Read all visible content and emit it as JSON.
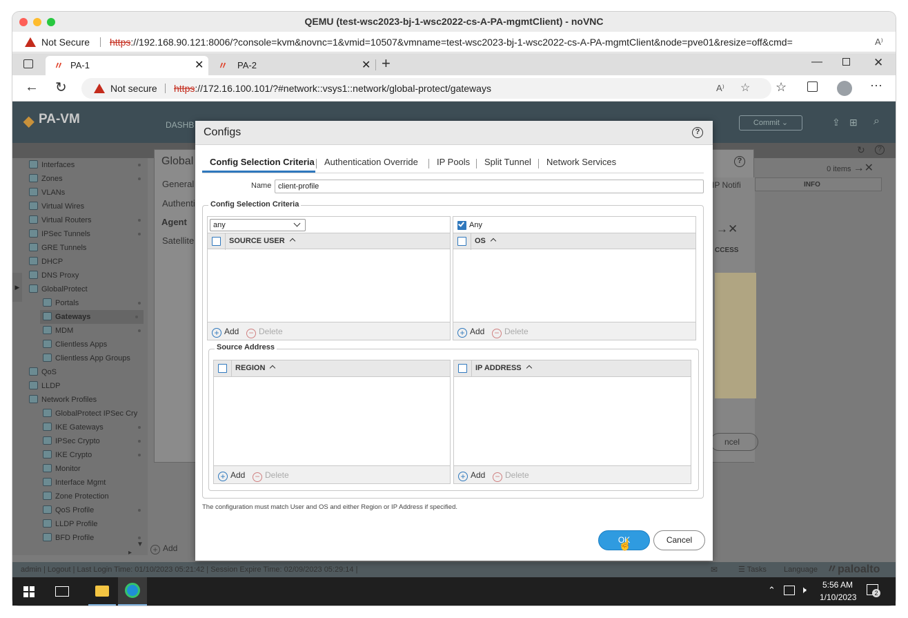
{
  "window": {
    "title": "QEMU (test-wsc2023-bj-1-wsc2022-cs-A-PA-mgmtClient) - noVNC"
  },
  "outer_addr": {
    "not_secure": "Not Secure",
    "scheme": "https",
    "url_rest": "://192.168.90.121:8006/?console=kvm&novnc=1&vmid=10507&vmname=test-wsc2023-bj-1-wsc2022-cs-A-PA-mgmtClient&node=pve01&resize=off&cmd="
  },
  "browser": {
    "tabs": [
      {
        "label": "PA-1"
      },
      {
        "label": "PA-2"
      }
    ],
    "not_secure": "Not secure",
    "scheme": "https",
    "url_rest": "://172.16.100.101/?#network::vsys1::network/global-protect/gateways"
  },
  "pa": {
    "logo": "PA-VM",
    "nav_partial": "DASHB",
    "commit": "Commit",
    "items_count": "0 items",
    "col_info": "INFO",
    "col_ip_notif": "IP Notifi",
    "col_access": "CCESS",
    "cancel_partial": "ncel",
    "sidebar": [
      {
        "label": "Interfaces"
      },
      {
        "label": "Zones"
      },
      {
        "label": "VLANs"
      },
      {
        "label": "Virtual Wires"
      },
      {
        "label": "Virtual Routers"
      },
      {
        "label": "IPSec Tunnels"
      },
      {
        "label": "GRE Tunnels"
      },
      {
        "label": "DHCP"
      },
      {
        "label": "DNS Proxy"
      },
      {
        "label": "GlobalProtect"
      },
      {
        "label": "Portals"
      },
      {
        "label": "Gateways"
      },
      {
        "label": "MDM"
      },
      {
        "label": "Clientless Apps"
      },
      {
        "label": "Clientless App Groups"
      },
      {
        "label": "QoS"
      },
      {
        "label": "LLDP"
      },
      {
        "label": "Network Profiles"
      },
      {
        "label": "GlobalProtect IPSec Cry"
      },
      {
        "label": "IKE Gateways"
      },
      {
        "label": "IPSec Crypto"
      },
      {
        "label": "IKE Crypto"
      },
      {
        "label": "Monitor"
      },
      {
        "label": "Interface Mgmt"
      },
      {
        "label": "Zone Protection"
      },
      {
        "label": "QoS Profile"
      },
      {
        "label": "LLDP Profile"
      },
      {
        "label": "BFD Profile"
      }
    ],
    "bg_dialog": {
      "title_partial": "Global",
      "tabs": [
        "General",
        "Authenti",
        "Agent",
        "Satellite"
      ]
    },
    "bottom_add": "Add",
    "status": "admin | Logout | Last Login Time: 01/10/2023 05:21:42 | Session Expire Time: 02/09/2023 05:29:14 |",
    "status_right": {
      "tasks": "Tasks",
      "language": "Language",
      "brand": "paloalto"
    }
  },
  "dialog": {
    "title": "Configs",
    "tabs": [
      "Config Selection Criteria",
      "Authentication Override",
      "IP Pools",
      "Split Tunnel",
      "Network Services"
    ],
    "name_label": "Name",
    "name_value": "client-profile",
    "criteria_legend": "Config Selection Criteria",
    "user_select": "any",
    "os_any_label": "Any",
    "col_source_user": "SOURCE USER",
    "col_os": "OS",
    "add": "Add",
    "delete": "Delete",
    "source_address_legend": "Source Address",
    "col_region": "REGION",
    "col_ip_address": "IP ADDRESS",
    "footnote": "The configuration must match User and OS and either Region or IP Address if specified.",
    "ok": "OK",
    "cancel": "Cancel"
  },
  "taskbar": {
    "time": "5:56 AM",
    "date": "1/10/2023",
    "notif_count": "2"
  }
}
